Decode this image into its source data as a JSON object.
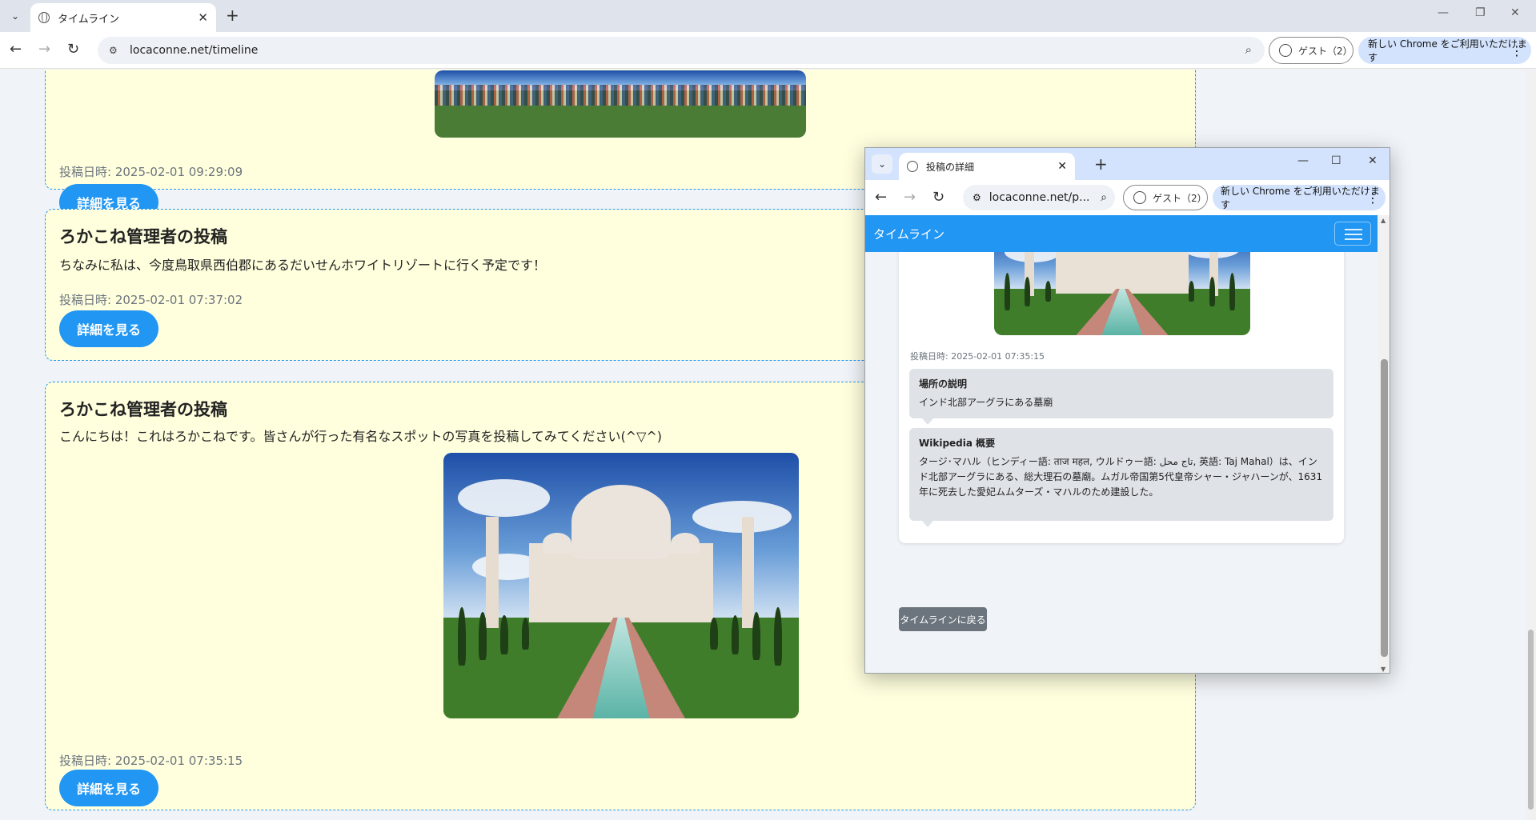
{
  "browser": {
    "tab_title": "タイムライン",
    "url": "locaconne.net/timeline",
    "guest_label": "ゲスト（2）",
    "promo_label": "新しい Chrome をご利用いただけます"
  },
  "posts": [
    {
      "date": "投稿日時: 2025-02-01 09:29:09",
      "button": "詳細を見る"
    },
    {
      "title": "ろかこね管理者の投稿",
      "body": "ちなみに私は、今度鳥取県西伯郡にあるだいせんホワイトリゾートに行く予定です！",
      "date": "投稿日時: 2025-02-01 07:37:02",
      "button": "詳細を見る"
    },
    {
      "title": "ろかこね管理者の投稿",
      "body": "こんにちは！これはろかこねです。皆さんが行った有名なスポットの写真を投稿してみてください(^▽^)",
      "date": "投稿日時: 2025-02-01 07:35:15",
      "button": "詳細を見る"
    }
  ],
  "popup": {
    "tab_title": "投稿の詳細",
    "url": "locaconne.net/p...",
    "guest_label": "ゲスト（2）",
    "promo_label": "新しい Chrome をご利用いただけます",
    "navbar_brand": "タイムライン",
    "date": "投稿日時: 2025-02-01 07:35:15",
    "location_heading": "場所の説明",
    "location_text": "インド北部アーグラにある墓廟",
    "wiki_heading": "Wikipedia 概要",
    "wiki_text": "タージ･マハル（ヒンディー語: ताज महल, ウルドゥー語: تاج محل, 英語: Taj Mahal）は、インド北部アーグラにある、総大理石の墓廟。ムガル帝国第5代皇帝シャー・ジャハーンが、1631年に死去した愛妃ムムターズ・マハルのため建設した。",
    "back_button": "タイムラインに戻る"
  }
}
